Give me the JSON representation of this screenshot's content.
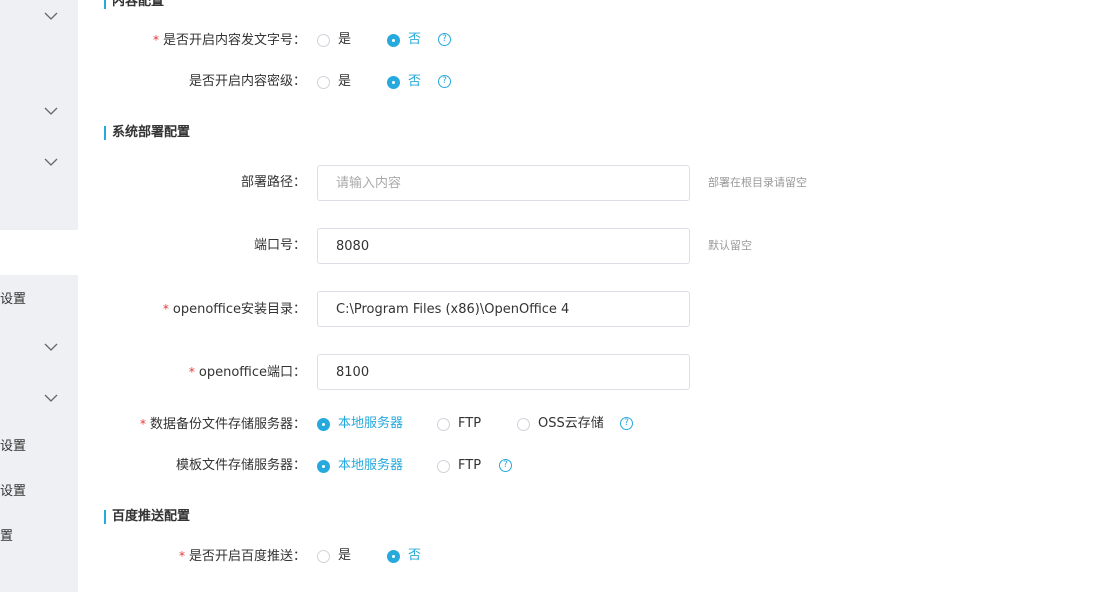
{
  "sidebar": {
    "labels": [
      "设置",
      "设置",
      "设置",
      "置"
    ]
  },
  "sections": {
    "content": {
      "title": "内容配置"
    },
    "deploy": {
      "title": "系统部署配置"
    },
    "baidu": {
      "title": "百度推送配置"
    }
  },
  "content_config": {
    "doc_number": {
      "label": "是否开启内容发文字号：",
      "options": [
        "是",
        "否"
      ],
      "selected": "否"
    },
    "secret_level": {
      "label": "是否开启内容密级：",
      "options": [
        "是",
        "否"
      ],
      "selected": "否"
    }
  },
  "deploy_config": {
    "path": {
      "label": "部署路径：",
      "value": "",
      "placeholder": "请输入内容",
      "hint": "部署在根目录请留空"
    },
    "port": {
      "label": "端口号：",
      "value": "8080",
      "hint": "默认留空"
    },
    "openoffice_dir": {
      "label": "openoffice安装目录：",
      "value": "C:\\Program Files (x86)\\OpenOffice 4"
    },
    "openoffice_port": {
      "label": "openoffice端口：",
      "value": "8100"
    },
    "backup_storage": {
      "label": "数据备份文件存储服务器：",
      "options": [
        "本地服务器",
        "FTP",
        "OSS云存储"
      ],
      "selected": "本地服务器"
    },
    "template_storage": {
      "label": "模板文件存储服务器：",
      "options": [
        "本地服务器",
        "FTP"
      ],
      "selected": "本地服务器"
    }
  },
  "baidu_config": {
    "push": {
      "label": "是否开启百度推送：",
      "options": [
        "是",
        "否"
      ],
      "selected": "否"
    }
  },
  "common": {
    "required_mark": "*",
    "help_glyph": "?"
  },
  "colors": {
    "accent": "#26a9dc",
    "required": "#e53935",
    "sidebar_bg": "#eef0f3",
    "hint": "#999999"
  },
  "icons": {
    "sidebar_expand": "chevron-down-icon",
    "help": "question-circle-icon"
  }
}
